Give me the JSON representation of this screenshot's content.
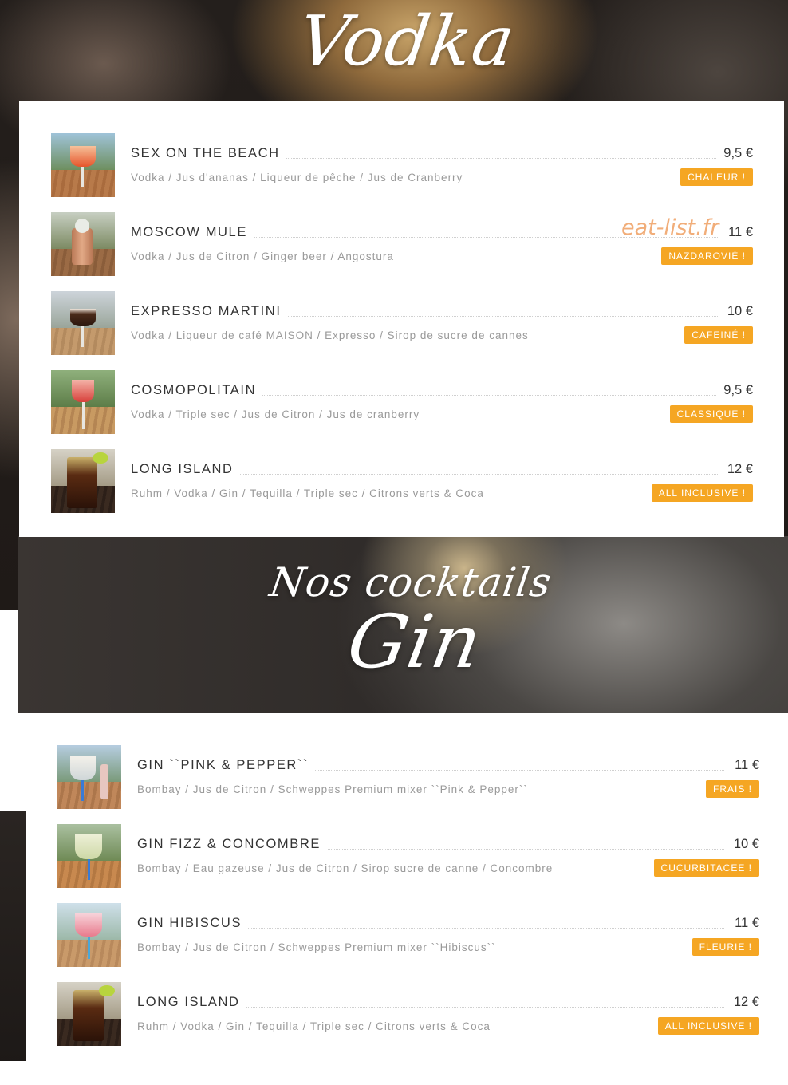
{
  "sections": {
    "vodka": {
      "title": "Vodka",
      "items": [
        {
          "name": "SEX ON THE BEACH",
          "description": "Vodka / Jus d'ananas / Liqueur de pêche / Jus de Cranberry",
          "price": "9,5 €",
          "badge": "CHALEUR !"
        },
        {
          "name": "MOSCOW MULE",
          "description": "Vodka / Jus de Citron / Ginger beer / Angostura",
          "price": "11 €",
          "badge": "NAZDAROVIÉ !"
        },
        {
          "name": "EXPRESSO MARTINI",
          "description": "Vodka / Liqueur de café MAISON / Expresso / Sirop de sucre de cannes",
          "price": "10 €",
          "badge": "CAFEINÉ !"
        },
        {
          "name": "COSMOPOLITAIN",
          "description": "Vodka / Triple sec / Jus de Citron / Jus de cranberry",
          "price": "9,5 €",
          "badge": "CLASSIQUE !"
        },
        {
          "name": "LONG ISLAND",
          "description": "Ruhm / Vodka / Gin / Tequilla / Triple sec / Citrons verts & Coca",
          "price": "12 €",
          "badge": "ALL INCLUSIVE !"
        }
      ]
    },
    "gin": {
      "subtitle": "Nos cocktails",
      "title": "Gin",
      "items": [
        {
          "name": "GIN ``PINK & PEPPER``",
          "description": "Bombay / Jus de Citron / Schweppes Premium mixer ``Pink & Pepper``",
          "price": "11 €",
          "badge": "FRAIS !"
        },
        {
          "name": "GIN FIZZ & CONCOMBRE",
          "description": "Bombay / Eau gazeuse / Jus de Citron / Sirop sucre de canne / Concombre",
          "price": "10 €",
          "badge": "CUCURBITACEE !"
        },
        {
          "name": "GIN HIBISCUS",
          "description": "Bombay / Jus de Citron / Schweppes Premium mixer ``Hibiscus``",
          "price": "11 €",
          "badge": "FLEURIE !"
        },
        {
          "name": "LONG ISLAND",
          "description": "Ruhm / Vodka / Gin / Tequilla / Triple sec / Citrons verts & Coca",
          "price": "12 €",
          "badge": "ALL INCLUSIVE !"
        }
      ]
    }
  },
  "watermark": "eat-list.fr",
  "colors": {
    "badge": "#f5a623",
    "watermark": "#f0a56b",
    "text_dark": "#333333",
    "text_muted": "#9a9a9a"
  },
  "icons": {
    "thumbnails": "cocktail-photo"
  }
}
